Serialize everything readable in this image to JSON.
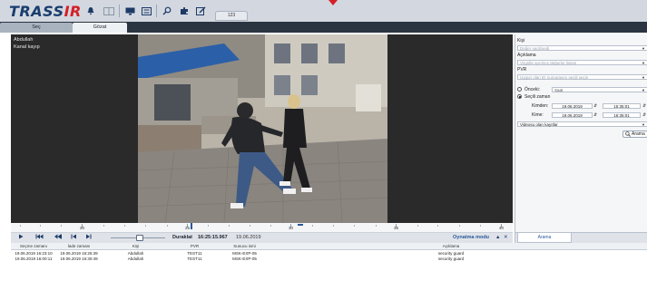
{
  "app": {
    "logo_main": "TRASS",
    "logo_accent": "IR",
    "tab_counter": "123"
  },
  "main_tabs": [
    {
      "label": "Seç"
    },
    {
      "label": "Gözat"
    }
  ],
  "video": {
    "camera_name": "Abdullah",
    "status_label": "Kanal kayıp"
  },
  "timeline": {
    "labels": [
      "20",
      "25",
      "30",
      "35",
      "40"
    ]
  },
  "controls": {
    "status": "Duraklat",
    "time": "16:25:15.967",
    "date": "19.06.2019",
    "mode_label": "Oynatma modu"
  },
  "table": {
    "headers": [
      "Seçme zamanı",
      "İade zamanı",
      "Kişi",
      "PVR",
      "Sunucu ismi",
      "Açıklama"
    ],
    "rows": [
      [
        "19.06.2019 16:23:10",
        "19.06.2019 16:25:39",
        "Abdullah",
        "TEST11",
        "MSK-EXP-05",
        "security guard"
      ],
      [
        "19.06.2019 16:00:11",
        "19.06.2019 16:30:49",
        "Abdullah",
        "TEST11",
        "MSK-EXP-05",
        "security guard"
      ]
    ]
  },
  "right_panel": {
    "person_label": "Kişi",
    "person_placeholder": "Değer seçilmedi",
    "description_label": "Açıklama",
    "description_placeholder": "Virgülle ayrılmış değerler listesi",
    "pvr_label": "PVR",
    "pvr_placeholder": "Uygun olan ID numarasını seçili seçin",
    "prev_label": "Önceki:",
    "prev_value": "Saat",
    "selected_time_label": "Seçili zaman",
    "from_label": "Kimden:",
    "from_date": "19.06.2019",
    "from_time": "15:35:01",
    "to_label": "Kime:",
    "to_date": "19.06.2019",
    "to_time": "16:35:01",
    "records_value": "Videosu olan kayıtlar",
    "search_button": "Arama",
    "bottom_tab": "Arama"
  },
  "colors": {
    "accent": "#2a5a9a",
    "brand_red": "#d42027",
    "brand_blue": "#1a3d6e"
  }
}
